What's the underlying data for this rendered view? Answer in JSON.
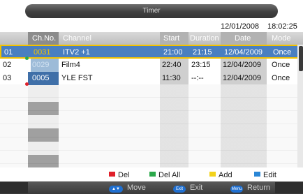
{
  "title": "Timer",
  "date": "12/01/2008",
  "time": "18:02:25",
  "columns": {
    "ch_no": "Ch.No.",
    "channel": "Channel",
    "start": "Start",
    "duration": "Duration",
    "date": "Date",
    "mode": "Mode"
  },
  "rows": [
    {
      "index": "01",
      "ch_no": "0031",
      "channel": "ITV2 +1",
      "start": "21:00",
      "duration": "21:15",
      "date": "12/04/2009",
      "mode": "Once"
    },
    {
      "index": "02",
      "ch_no": "0029",
      "channel": "Film4",
      "start": "22:40",
      "duration": "23:15",
      "date": "12/04/2009",
      "mode": "Once"
    },
    {
      "index": "03",
      "ch_no": "0005",
      "channel": "YLE FST",
      "start": "11:30",
      "duration": "--:--",
      "date": "12/04/2009",
      "mode": "Once"
    }
  ],
  "legend": {
    "del": "Del",
    "del_all": "Del All",
    "add": "Add",
    "edit": "Edit"
  },
  "footer": {
    "move": "Move",
    "exit": "Exit",
    "exit_icon": "Exit",
    "return": "Return",
    "return_icon": "Menu"
  },
  "colors": {
    "selected_row": "#4a7fc0",
    "selection_border": "#f2c200",
    "red": "#e0202a",
    "green": "#2aa84a",
    "yellow": "#f2d21a",
    "blue": "#2a86d6"
  }
}
